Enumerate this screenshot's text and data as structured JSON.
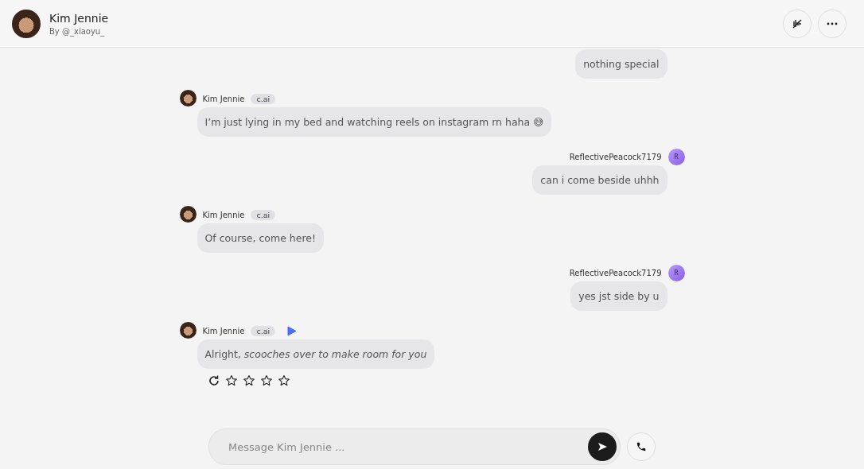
{
  "header": {
    "name": "Kim Jennie",
    "creator": "By @_xiaoyu_"
  },
  "messages": [
    {
      "kind": "user",
      "text": "nothing special"
    },
    {
      "kind": "bot",
      "name": "Kim Jennie",
      "badge": "c.ai",
      "playable": false,
      "text": "I’m just lying in my bed and watching reels on instagram rn haha 😅"
    },
    {
      "kind": "user",
      "name": "ReflectivePeacock7179",
      "initial": "R",
      "text": "can i come beside uhhh"
    },
    {
      "kind": "bot",
      "name": "Kim Jennie",
      "badge": "c.ai",
      "playable": false,
      "text": "Of course, come here!"
    },
    {
      "kind": "user",
      "name": "ReflectivePeacock7179",
      "initial": "R",
      "text": "yes jst side by u"
    },
    {
      "kind": "bot",
      "name": "Kim Jennie",
      "badge": "c.ai",
      "playable": true,
      "text": "Alright, *scooches over to make room for you*",
      "stars": 0
    }
  ],
  "composer": {
    "placeholder": "Message Kim Jennie ..."
  }
}
